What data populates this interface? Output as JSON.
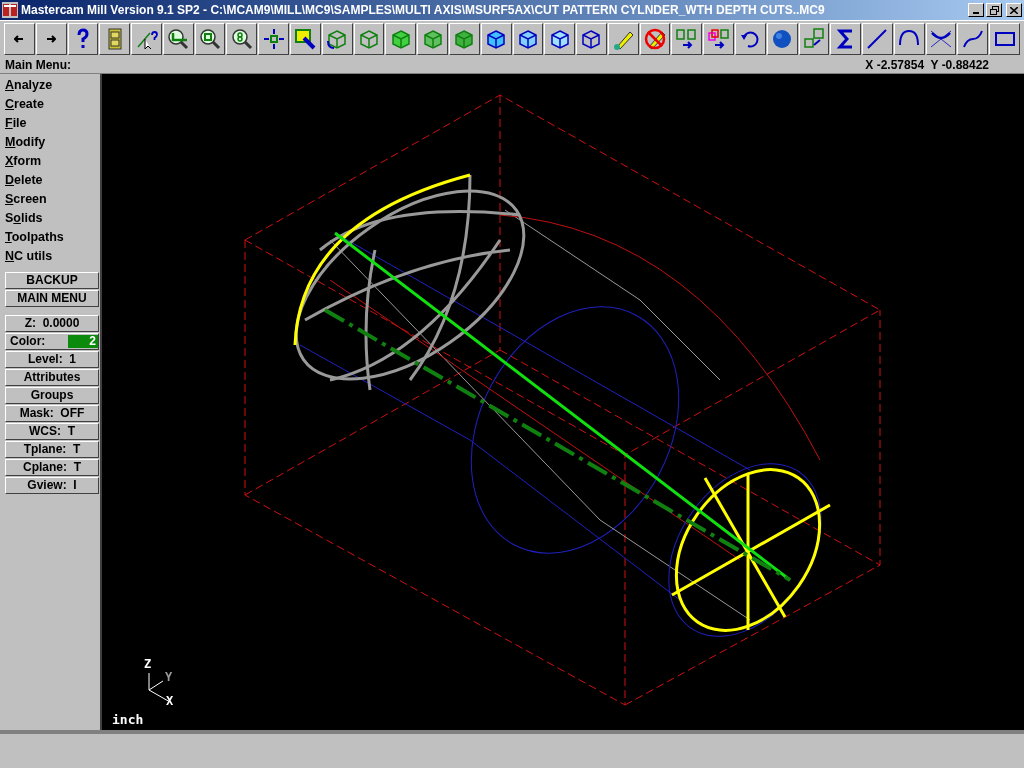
{
  "window": {
    "title": "Mastercam Mill Version 9.1 SP2 - C:\\MCAM9\\MILL\\MC9\\SAMPLES\\MULTI AXIS\\MSURF5AX\\CUT PATTERN CYLNDER_WTH DEPTH CUTS..MC9"
  },
  "menu_header": {
    "title": "Main Menu:",
    "coordinates": "X -2.57854  Y -0.88422"
  },
  "main_menu": [
    {
      "key": "A",
      "after": "nalyze"
    },
    {
      "key": "C",
      "after": "reate"
    },
    {
      "key": "F",
      "after": "ile"
    },
    {
      "key": "M",
      "after": "odify"
    },
    {
      "key": "X",
      "after": "form"
    },
    {
      "key": "D",
      "after": "elete"
    },
    {
      "key": "S",
      "after": "creen"
    },
    {
      "before": "S",
      "key": "o",
      "after": "lids"
    },
    {
      "key": "T",
      "after": "oolpaths"
    },
    {
      "key": "N",
      "after": "C utils"
    }
  ],
  "nav_buttons": [
    "BACKUP",
    "MAIN MENU"
  ],
  "settings": [
    {
      "kind": "plain",
      "label": "Z:  0.0000"
    },
    {
      "kind": "color",
      "label": "Color:",
      "value": "2",
      "color": "#0b8a0b"
    },
    {
      "kind": "plain",
      "label": "Level:  1"
    },
    {
      "kind": "plain",
      "label": "Attributes"
    },
    {
      "kind": "plain",
      "label": "Groups"
    },
    {
      "kind": "plain",
      "label": "Mask:  OFF"
    },
    {
      "kind": "plain",
      "label": "WCS:  T"
    },
    {
      "kind": "plain",
      "label": "Tplane:  T"
    },
    {
      "kind": "plain",
      "label": "Cplane:  T"
    },
    {
      "kind": "plain",
      "label": "Gview:  I"
    }
  ],
  "viewport": {
    "axes": [
      "Z",
      "Y",
      "X"
    ],
    "units": "inch"
  }
}
